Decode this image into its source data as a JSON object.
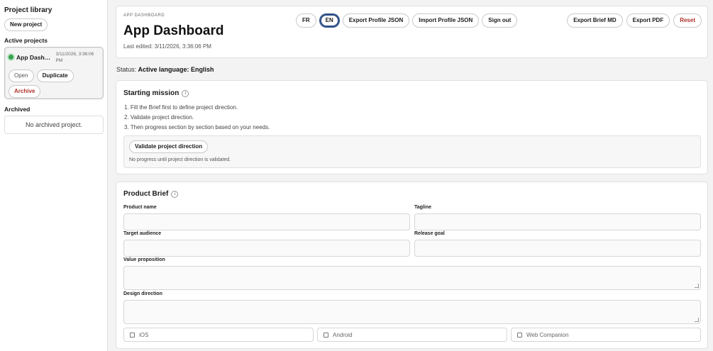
{
  "sidebar": {
    "title": "Project library",
    "new_project": "New project",
    "active_label": "Active projects",
    "project": {
      "name": "App Dashb...",
      "date": "3/11/2026, 3:36:06 PM",
      "open": "Open",
      "duplicate": "Duplicate",
      "archive": "Archive"
    },
    "archived_label": "Archived",
    "archived_empty": "No archived project."
  },
  "header": {
    "eyebrow": "APP DASHBOARD",
    "title": "App Dashboard",
    "edited": "Last edited: 3/11/2026, 3:36:06 PM",
    "lang_fr": "FR",
    "lang_en": "EN",
    "export_profile": "Export Profile JSON",
    "import_profile": "Import Profile JSON",
    "sign_out": "Sign out",
    "export_brief": "Export Brief MD",
    "export_pdf": "Export PDF",
    "reset": "Reset"
  },
  "status": {
    "prefix": "Status:",
    "value": "Active language: English"
  },
  "mission": {
    "title": "Starting mission",
    "steps": [
      "1. Fill the Brief first to define project direction.",
      "2. Validate project direction.",
      "3. Then progress section by section based on your needs."
    ],
    "validate_button": "Validate project direction",
    "note": "No progress until project direction is validated."
  },
  "brief": {
    "title": "Product Brief",
    "product_name": "Product name",
    "tagline": "Tagline",
    "target_audience": "Target audience",
    "release_goal": "Release goal",
    "value_proposition": "Value proposition",
    "design_direction": "Design direction",
    "platforms": [
      "iOS",
      "Android",
      "Web Companion"
    ]
  },
  "icons": {
    "info": "info-icon",
    "active_dot": "status-dot-icon"
  },
  "colors": {
    "danger": "#b1302c",
    "active_dot": "#35a34a",
    "active_lang_ring": "#2d4f88"
  }
}
